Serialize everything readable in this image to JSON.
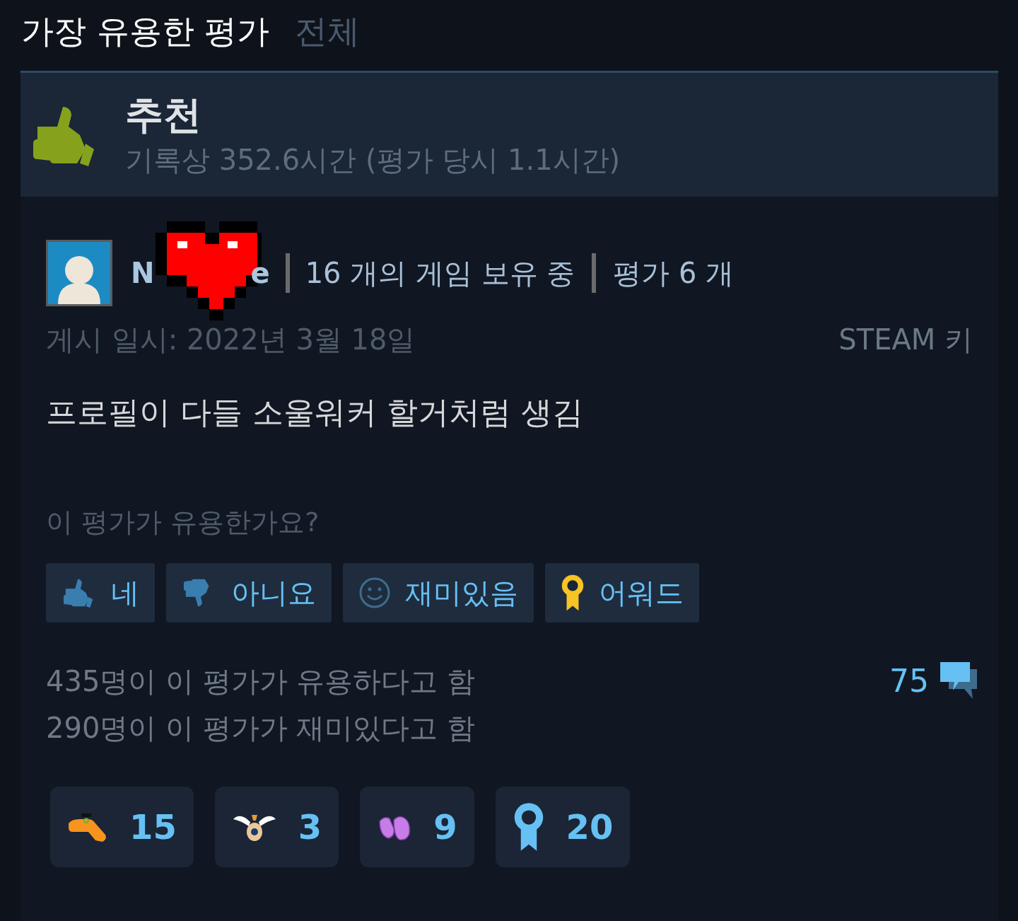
{
  "header": {
    "title": "가장 유용한 평가",
    "link": "전체"
  },
  "verdict": {
    "kind": "recommended",
    "label": "추천",
    "hours": "기록상 352.6시간 (평가 당시 1.1시간)"
  },
  "author": {
    "name_start": "N",
    "name_end": "e",
    "games": "16 개의 게임 보유 중",
    "reviews": "평가 6 개"
  },
  "posted": "게시 일시: 2022년 3월 18일",
  "source": "STEAM 키",
  "review_text": "프로필이 다들 소울워커 할거처럼 생김",
  "helpful_prompt": "이 평가가 유용한가요?",
  "vote_buttons": [
    {
      "kind": "yes",
      "label": "네"
    },
    {
      "kind": "no",
      "label": "아니요"
    },
    {
      "kind": "funny",
      "label": "재미있음"
    },
    {
      "kind": "award",
      "label": "어워드"
    }
  ],
  "stats": [
    "435명이 이 평가가 유용하다고 함",
    "290명이 이 평가가 재미있다고 함"
  ],
  "comment_count": "75",
  "awards": [
    {
      "kind": "dino",
      "count": "15"
    },
    {
      "kind": "wings",
      "count": "3"
    },
    {
      "kind": "clap",
      "count": "9"
    },
    {
      "kind": "ribbon",
      "count": "20"
    }
  ]
}
